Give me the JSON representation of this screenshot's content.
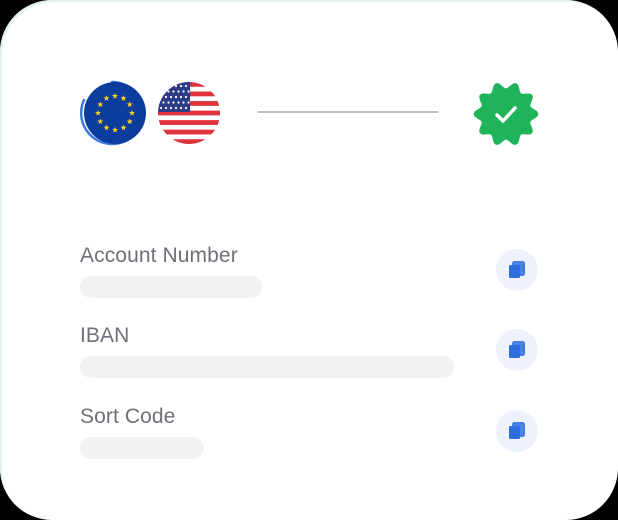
{
  "currency_pair": {
    "from_flag": "eu-flag",
    "to_flag": "us-flag",
    "status_icon": "verified-badge-icon"
  },
  "colors": {
    "eu_blue": "#0c3c9c",
    "eu_star": "#ffd21f",
    "ring_blue": "#3b79e6",
    "us_red": "#e0323a",
    "us_blue": "#2d3c86",
    "verified_green": "#1fb35a",
    "copy_icon_blue": "#2e6fe0",
    "copy_bg": "#eef3fb",
    "placeholder": "#f2f2f3",
    "label_gray": "#6e7179"
  },
  "fields": [
    {
      "label": "Account Number",
      "value_fill": 0.4,
      "copy_icon": "copy-icon"
    },
    {
      "label": "IBAN",
      "value_fill": 0.81,
      "copy_icon": "copy-icon"
    },
    {
      "label": "Sort Code",
      "value_fill": 0.27,
      "copy_icon": "copy-icon"
    }
  ]
}
